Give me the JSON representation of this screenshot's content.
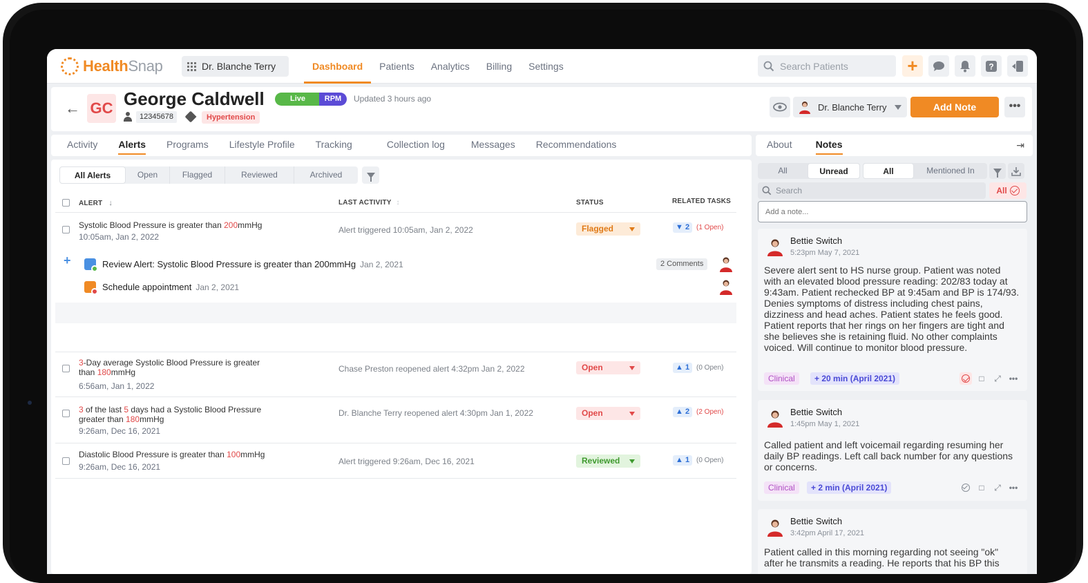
{
  "app": {
    "logo_brand": "Health",
    "logo_brand_2": "Snap",
    "doctor_switch": "Dr. Blanche Terry",
    "nav": [
      "Dashboard",
      "Patients",
      "Analytics",
      "Billing",
      "Settings"
    ],
    "search_placeholder": "Search Patients",
    "accent": "#f08a24"
  },
  "patient": {
    "initials": "GC",
    "name": "George Caldwell",
    "badge_live": "Live",
    "badge_rpm": "RPM",
    "updated": "Updated 3 hours ago",
    "id": "12345678",
    "condition": "Hypertension",
    "assignee": "Dr. Blanche Terry",
    "add_note": "Add Note"
  },
  "left_tabs": [
    "Activity",
    "Alerts",
    "Programs",
    "Lifestyle Profile",
    "Tracking",
    "Collection log",
    "Messages",
    "Recommendations"
  ],
  "alert_filters": [
    "All Alerts",
    "Open",
    "Flagged",
    "Reviewed",
    "Archived"
  ],
  "table_headers": {
    "alert": "ALERT",
    "last_activity": "LAST ACTIVITY",
    "status": "STATUS",
    "related_tasks": "RELATED TASKS"
  },
  "alerts": [
    {
      "pre": "Systolic Blood Pressure is greater than ",
      "n1": "200",
      "mid": "mmHg",
      "time": "10:05am, Jan 2, 2022",
      "activity": "Alert triggered 10:05am, Jan 2, 2022",
      "status": "Flagged",
      "task_count": "2",
      "task_open": "(1 Open)"
    },
    {
      "n0": "3",
      "pre": "-Day average Systolic Blood Pressure is greater",
      "line2_pre": "than ",
      "n1": "180",
      "mid": "mmHg",
      "time": "6:56am, Jan 1, 2022",
      "activity": "Chase Preston reopened alert 4:32pm Jan 2, 2022",
      "status": "Open",
      "task_count": "1",
      "task_open": "(0 Open)"
    },
    {
      "n0": "3",
      "pre": " of the last ",
      "n05": "5",
      "pre2": " days had a Systolic Blood Pressure",
      "line2_pre": "greater than ",
      "n1": "180",
      "mid": "mmHg",
      "time": "9:26am, Dec 16, 2021",
      "activity": "Dr. Blanche Terry reopened alert 4:30pm Jan 1, 2022",
      "status": "Open",
      "task_count": "2",
      "task_open": "(2 Open)"
    },
    {
      "pre": "Diastolic Blood Pressure is greater than ",
      "n1": "100",
      "mid": "mmHg",
      "time": "9:26am, Dec 16, 2021",
      "activity": "Alert triggered 9:26am, Dec 16, 2021",
      "status": "Reviewed",
      "task_count": "1",
      "task_open": "(0 Open)"
    }
  ],
  "subtasks": [
    {
      "title": "Review Alert: Systolic Blood Pressure is greater than 200mmHg",
      "date": "Jan 2, 2021",
      "comments": "2 Comments"
    },
    {
      "title": "Schedule appointment",
      "date": "Jan 2, 2021"
    }
  ],
  "right_tabs": [
    "About",
    "Notes"
  ],
  "notes_filters": {
    "left": [
      "All",
      "Unread"
    ],
    "right": [
      "All",
      "Mentioned In"
    ]
  },
  "notes_search": "Search",
  "notes_all_chip": "All",
  "add_note_placeholder": "Add a note...",
  "notes": [
    {
      "author": "Bettie Switch",
      "time": "5:23pm May 7, 2021",
      "body": "Severe alert sent to HS nurse group. Patient was noted with an elevated blood pressure reading: 202/83 today at 9:43am. Patient rechecked BP at 9:45am and BP is 174/93. Denies symptoms of distress including chest pains, dizziness and head aches. Patient states he feels good. Patient reports that her rings on her fingers are tight and she believes she is retaining fluid. No other complaints voiced. Will continue to monitor blood pressure.",
      "tag": "Clinical",
      "duration": "+ 20 min (April 2021)"
    },
    {
      "author": "Bettie Switch",
      "time": "1:45pm May 1, 2021",
      "body": "Called patient and left voicemail regarding resuming her daily BP readings. Left call back number for any questions or concerns.",
      "tag": "Clinical",
      "duration": "+ 2 min (April 2021)"
    },
    {
      "author": "Bettie Switch",
      "time": "3:42pm April 17, 2021",
      "body": "Patient called in this morning regarding not seeing \"ok\" after he transmits a reading. He reports that his BP this"
    }
  ]
}
